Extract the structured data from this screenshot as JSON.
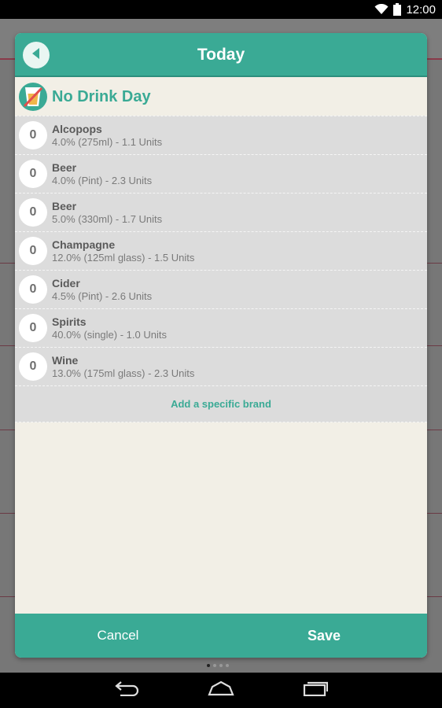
{
  "status_bar": {
    "time": "12:00"
  },
  "dialog": {
    "title": "Today",
    "no_drink_label": "No Drink Day",
    "drinks": [
      {
        "count": "0",
        "name": "Alcopops",
        "detail": "4.0% (275ml) - 1.1 Units"
      },
      {
        "count": "0",
        "name": "Beer",
        "detail": "4.0% (Pint) - 2.3 Units"
      },
      {
        "count": "0",
        "name": "Beer",
        "detail": "5.0% (330ml) - 1.7 Units"
      },
      {
        "count": "0",
        "name": "Champagne",
        "detail": "12.0% (125ml glass) - 1.5 Units"
      },
      {
        "count": "0",
        "name": "Cider",
        "detail": "4.5% (Pint) - 2.6 Units"
      },
      {
        "count": "0",
        "name": "Spirits",
        "detail": "40.0% (single) - 1.0 Units"
      },
      {
        "count": "0",
        "name": "Wine",
        "detail": "13.0% (175ml glass) - 2.3 Units"
      }
    ],
    "add_brand_label": "Add a specific brand",
    "cancel_label": "Cancel",
    "save_label": "Save"
  },
  "colors": {
    "accent": "#3aaa95",
    "row_bg": "#dcdcdc",
    "panel_bg": "#f2efe6"
  },
  "icons": {
    "back": "back-arrow-icon",
    "no_drink": "no-drink-glass-icon",
    "wifi": "wifi-icon",
    "battery": "battery-icon",
    "nav_back": "nav-back-icon",
    "nav_home": "nav-home-icon",
    "nav_recents": "nav-recents-icon"
  }
}
